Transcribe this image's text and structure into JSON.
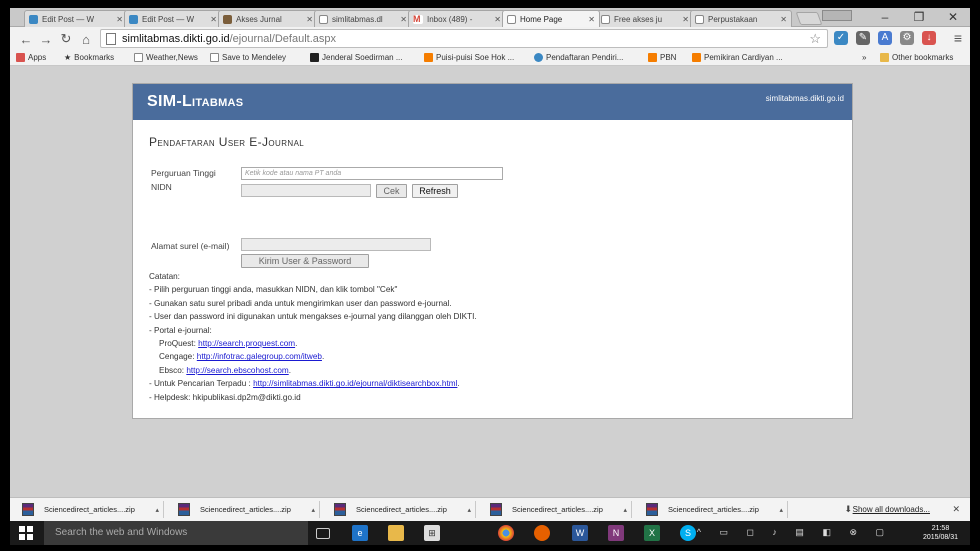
{
  "browser": {
    "tabs": [
      {
        "label": "Edit Post — W",
        "color": "#3b88c3"
      },
      {
        "label": "Edit Post — W",
        "color": "#3b88c3"
      },
      {
        "label": "Akses Jurnal",
        "color": "#7b5e3b"
      },
      {
        "label": "simlitabmas.dl",
        "color": "#ffffff"
      },
      {
        "label": "Inbox (489) -",
        "color": "#d44638"
      },
      {
        "label": "Home Page",
        "color": "#ffffff"
      },
      {
        "label": "Free akses ju",
        "color": "#ffffff"
      },
      {
        "label": "Perpustakaan",
        "color": "#ffffff"
      }
    ],
    "active_tab_index": 5,
    "url_host": "simlitabmas.dikti.go.id",
    "url_path": "/ejournal/Default.aspx"
  },
  "bookmarks": [
    {
      "label": "Apps",
      "color": "#d9534f"
    },
    {
      "label": "Bookmarks",
      "color": "#555555"
    },
    {
      "label": "Weather,News",
      "color": "#ffffff"
    },
    {
      "label": "Save to Mendeley",
      "color": "#ffffff"
    },
    {
      "label": "Jenderal Soedirman ...",
      "color": "#222222"
    },
    {
      "label": "Puisi-puisi Soe Hok ...",
      "color": "#f57d00"
    },
    {
      "label": "Pendaftaran Pendiri...",
      "color": "#3b88c3"
    },
    {
      "label": "PBN",
      "color": "#f57d00"
    },
    {
      "label": "Pemikiran Cardiyan ...",
      "color": "#f57d00"
    },
    {
      "label": "Other bookmarks",
      "color": "#e8b84a"
    }
  ],
  "site": {
    "brand": "SIM-Litabmas",
    "host": "simlitabmas.dikti.go.id",
    "form_title": "Pendaftaran User E-Journal",
    "labels": {
      "pt": "Perguruan Tinggi",
      "nidn": "NIDN",
      "email": "Alamat surel (e-mail)"
    },
    "pt_placeholder": "Ketik kode atau nama PT anda",
    "buttons": {
      "cek": "Cek",
      "refresh": "Refresh",
      "kirim": "Kirim User & Password"
    },
    "notes_title": "Catatan:",
    "notes": [
      "- Pilih perguruan tinggi anda, masukkan NIDN, dan klik tombol \"Cek\"",
      "- Gunakan satu surel pribadi anda untuk mengirimkan user dan password e-journal.",
      "- User dan password ini digunakan untuk mengakses e-journal yang dilanggan oleh DIKTI.",
      "- Portal e-journal:"
    ],
    "portals": [
      {
        "name": "ProQuest:",
        "link": "http://search.proquest.com",
        "suffix": "."
      },
      {
        "name": "Cengage:",
        "link": "http://infotrac.galegroup.com/itweb",
        "suffix": "."
      },
      {
        "name": "Ebsco:",
        "link": "http://search.ebscohost.com",
        "suffix": "."
      }
    ],
    "search_prefix": "- Untuk Pencarian Terpadu :",
    "search_link": "http://simlitabmas.dikti.go.id/ejournal/diktisearchbox.html",
    "search_suffix": ".",
    "helpdesk": "- Helpdesk: hkipublikasi.dp2m@dikti.go.id"
  },
  "downloads": {
    "items": [
      "Sciencedirect_articles....zip",
      "Sciencedirect_articles....zip",
      "Sciencedirect_articles....zip",
      "Sciencedirect_articles....zip",
      "Sciencedirect_articles....zip"
    ],
    "show_all": "Show all downloads..."
  },
  "taskbar": {
    "search_placeholder": "Search the web and Windows",
    "time": "21:58",
    "date": "2015/08/31"
  }
}
